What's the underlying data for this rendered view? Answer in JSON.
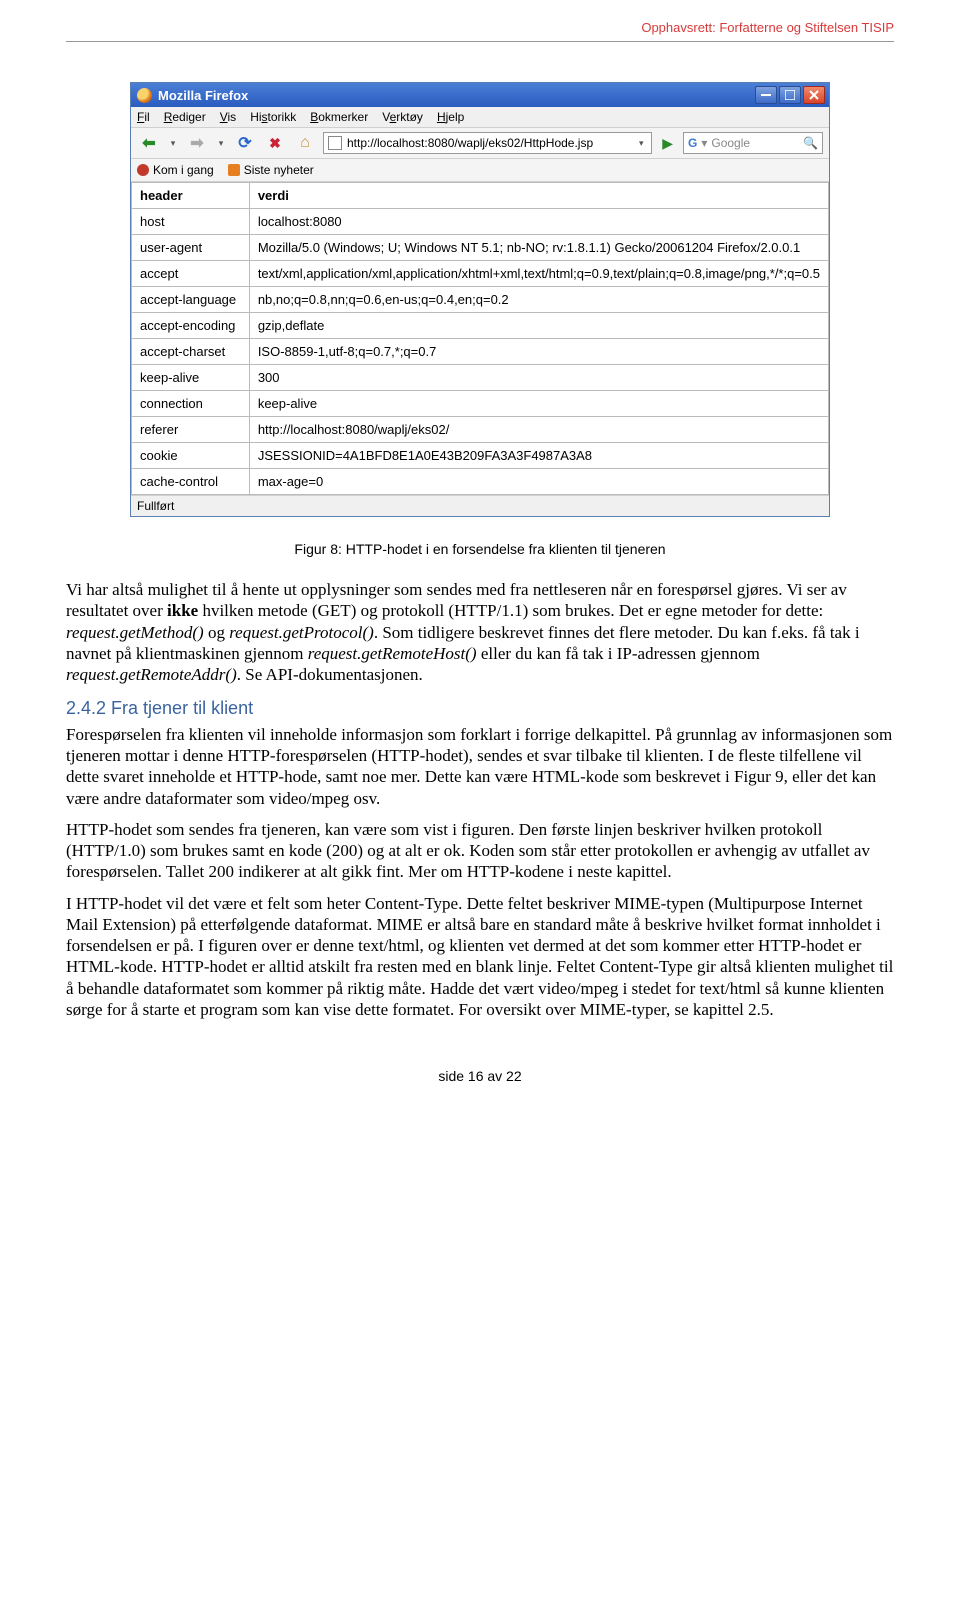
{
  "copyright": "Opphavsrett: Forfatterne og Stiftelsen TISIP",
  "browser": {
    "title": "Mozilla Firefox",
    "menu": {
      "fil": "Fil",
      "rediger": "Rediger",
      "vis": "Vis",
      "historikk": "Historikk",
      "bokmerker": "Bokmerker",
      "verktoy": "Verktøy",
      "hjelp": "Hjelp"
    },
    "url": "http://localhost:8080/waplj/eks02/HttpHode.jsp",
    "search_placeholder": "Google",
    "bookmarks": {
      "kom_i_gang": "Kom i gang",
      "siste_nyheter": "Siste nyheter"
    },
    "table": {
      "header_col": "header",
      "verdi_col": "verdi",
      "rows": [
        {
          "k": "host",
          "v": "localhost:8080"
        },
        {
          "k": "user-agent",
          "v": "Mozilla/5.0 (Windows; U; Windows NT 5.1; nb-NO; rv:1.8.1.1) Gecko/20061204 Firefox/2.0.0.1"
        },
        {
          "k": "accept",
          "v": "text/xml,application/xml,application/xhtml+xml,text/html;q=0.9,text/plain;q=0.8,image/png,*/*;q=0.5"
        },
        {
          "k": "accept-language",
          "v": "nb,no;q=0.8,nn;q=0.6,en-us;q=0.4,en;q=0.2"
        },
        {
          "k": "accept-encoding",
          "v": "gzip,deflate"
        },
        {
          "k": "accept-charset",
          "v": "ISO-8859-1,utf-8;q=0.7,*;q=0.7"
        },
        {
          "k": "keep-alive",
          "v": "300"
        },
        {
          "k": "connection",
          "v": "keep-alive"
        },
        {
          "k": "referer",
          "v": "http://localhost:8080/waplj/eks02/"
        },
        {
          "k": "cookie",
          "v": "JSESSIONID=4A1BFD8E1A0E43B209FA3A3F4987A3A8"
        },
        {
          "k": "cache-control",
          "v": "max-age=0"
        }
      ]
    },
    "status": "Fullført"
  },
  "caption": "Figur 8: HTTP-hodet i en forsendelse fra klienten til tjeneren",
  "para1_a": "Vi har altså mulighet til å hente ut opplysninger som sendes med fra nettleseren når en forespørsel gjøres. Vi ser av resultatet over ",
  "para1_b": "ikke",
  "para1_c": " hvilken metode (GET) og protokoll (HTTP/1.1) som brukes. Det er egne metoder for dette: ",
  "para1_d": "request.getMethod()",
  "para1_e": " og ",
  "para1_f": "request.getProtocol()",
  "para1_g": ". Som tidligere beskrevet finnes det flere metoder. Du kan f.eks. få tak i navnet på klientmaskinen gjennom ",
  "para1_h": "request.getRemoteHost()",
  "para1_i": " eller du kan få tak i IP-adressen gjennom ",
  "para1_j": "request.getRemoteAddr()",
  "para1_k": ". Se API-dokumentasjonen.",
  "subhead": "2.4.2   Fra tjener til klient",
  "para2": "Forespørselen fra klienten vil inneholde informasjon som forklart i forrige delkapittel. På grunnlag av informasjonen som tjeneren mottar i denne HTTP-forespørselen (HTTP-hodet), sendes et svar tilbake til klienten. I de fleste tilfellene vil dette svaret inneholde et HTTP-hode, samt noe mer. Dette kan være HTML-kode som beskrevet i Figur 9, eller det kan være andre dataformater som video/mpeg osv.",
  "para3": "HTTP-hodet som sendes fra tjeneren, kan være som vist i figuren. Den første linjen beskriver hvilken protokoll (HTTP/1.0) som brukes samt en kode (200) og at alt er ok. Koden som står etter protokollen er avhengig av utfallet av forespørselen. Tallet 200 indikerer at alt gikk fint. Mer om HTTP-kodene i neste kapittel.",
  "para4": "I HTTP-hodet vil det være et felt som heter Content-Type. Dette feltet beskriver MIME-typen (Multipurpose Internet Mail Extension) på etterfølgende dataformat. MIME er altså bare en standard måte å beskrive hvilket format innholdet i forsendelsen er på. I figuren over er denne text/html, og klienten vet dermed at det som kommer etter HTTP-hodet er HTML-kode. HTTP-hodet er alltid atskilt fra resten med en blank linje. Feltet Content-Type gir altså klienten mulighet til å behandle dataformatet som kommer på riktig måte. Hadde det vært video/mpeg i stedet for text/html så kunne klienten sørge for å starte et program som kan vise dette formatet. For oversikt over MIME-typer, se kapittel 2.5.",
  "footer": "side 16 av 22"
}
